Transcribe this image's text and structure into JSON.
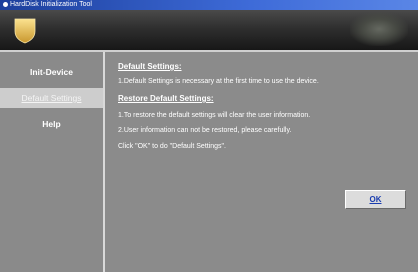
{
  "window": {
    "title": "HardDisk Initialization Tool"
  },
  "sidebar": {
    "items": [
      {
        "label": "Init-Device"
      },
      {
        "label": "Default Settings"
      },
      {
        "label": "Help"
      }
    ]
  },
  "content": {
    "default_heading": "Default Settings:",
    "default_text": "1.Default Settings is necessary at the first time to use the device.",
    "restore_heading": "Restore Default Settings:",
    "restore_line1": "1.To restore the default settings will clear the user information.",
    "restore_line2": "2.User information can not be restored, please carefully.",
    "instruction": "Click \"OK\" to do \"Default Settings\".",
    "ok_label": "OK"
  },
  "colors": {
    "background": "#8b8b8b",
    "active_nav": "#cdcdcd",
    "title_bar": "#2f5fc8",
    "ok_text": "#1a3db0",
    "logo": "#e8c25a"
  },
  "icons": {
    "app_icon": "app-icon",
    "logo": "shield-logo-icon"
  }
}
